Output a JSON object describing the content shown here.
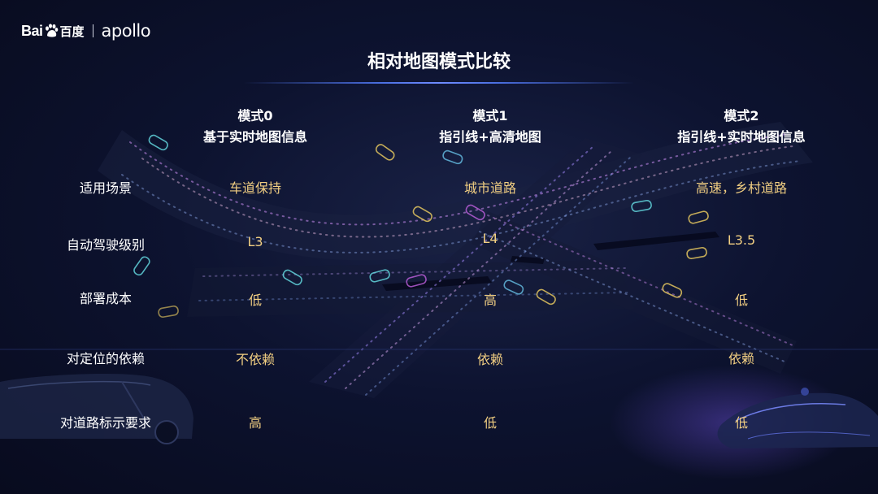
{
  "brand": {
    "baidu": "Bai",
    "baidu_cn": "百度",
    "product": "apollo"
  },
  "title": "相对地图模式比较",
  "columns": [
    {
      "mode": "模式0",
      "desc": "基于实时地图信息"
    },
    {
      "mode": "模式1",
      "desc": "指引线+高清地图"
    },
    {
      "mode": "模式2",
      "desc": "指引线+实时地图信息"
    }
  ],
  "rows": [
    {
      "label": "适用场景",
      "values": [
        "车道保持",
        "城市道路",
        "高速，乡村道路"
      ]
    },
    {
      "label": "自动驾驶级别",
      "values": [
        "L3",
        "L4",
        "L3.5"
      ]
    },
    {
      "label": "部署成本",
      "values": [
        "低",
        "高",
        "低"
      ]
    },
    {
      "label": "对定位的依赖",
      "values": [
        "不依赖",
        "依赖",
        "依赖"
      ]
    },
    {
      "label": "对道路标示要求",
      "values": [
        "高",
        "低",
        "低"
      ]
    }
  ],
  "colors": {
    "value_text": "#f2cf82",
    "accent_line": "#4a6ee0",
    "background": "#0d1330"
  }
}
